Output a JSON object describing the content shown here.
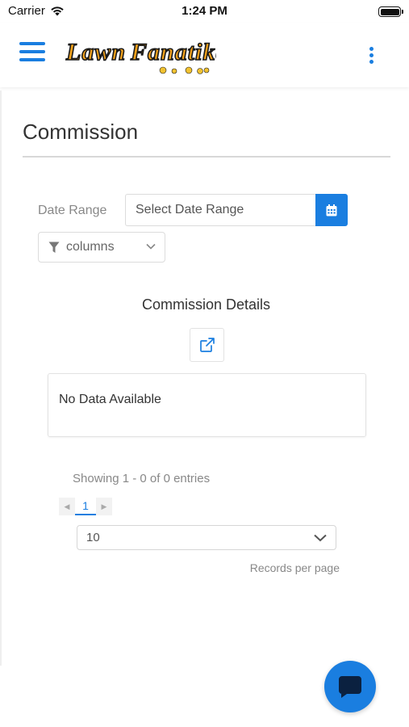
{
  "status_bar": {
    "carrier": "Carrier",
    "time": "1:24 PM"
  },
  "header": {
    "logo_text": "Lawn Fanatike",
    "icons": [
      "menu-icon",
      "logo-image",
      "more-vertical-icon"
    ]
  },
  "page": {
    "title": "Commission"
  },
  "filters": {
    "date_range_label": "Date Range",
    "date_range_placeholder": "Select Date Range",
    "columns_label": "columns"
  },
  "details": {
    "title": "Commission Details",
    "empty_message": "No Data Available"
  },
  "pagination": {
    "showing_text": "Showing 1 - 0 of 0 entries",
    "current_page": "1",
    "per_page_value": "10",
    "records_label": "Records per page"
  },
  "colors": {
    "accent": "#1a7ee0",
    "logo_orange": "#f2a11a"
  }
}
